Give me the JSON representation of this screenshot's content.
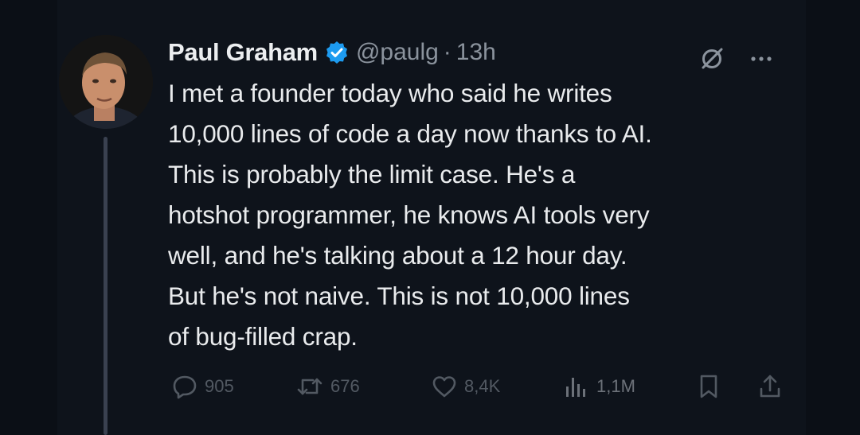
{
  "tweet": {
    "author_name": "Paul Graham",
    "handle": "@paulg",
    "separator": "·",
    "time_ago": "13h",
    "text": "I met a founder today who said he writes\n10,000 lines of code a day now thanks to AI.\nThis is probably the limit case. He's a\nhotshot programmer, he knows AI tools very\nwell, and he's talking about a 12 hour day.\nBut he's not naive. This is not 10,000 lines\nof bug-filled crap."
  },
  "actions": {
    "replies": "905",
    "reposts": "676",
    "likes": "8,4K",
    "views": "1,1M"
  },
  "icons": {
    "verified": "verified-badge-icon",
    "grok": "grok-icon",
    "more": "more-icon",
    "reply": "reply-icon",
    "repost": "repost-icon",
    "like": "heart-icon",
    "views": "views-icon",
    "bookmark": "bookmark-icon",
    "share": "share-icon"
  },
  "colors": {
    "background": "#0e131b",
    "text": "#e9ebed",
    "muted": "#8b939d",
    "verified": "#1d9bf0"
  }
}
